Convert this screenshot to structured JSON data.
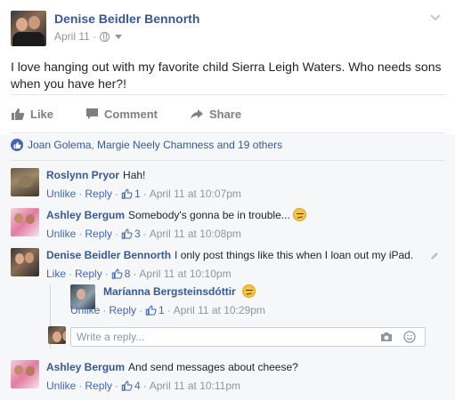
{
  "post": {
    "author": "Denise Beidler Bennorth",
    "date": "April 11 ·",
    "text": "I love hanging out with my favorite child Sierra Leigh Waters. Who needs sons when you have her?!"
  },
  "actions": {
    "like": "Like",
    "comment": "Comment",
    "share": "Share"
  },
  "likes_summary": "Joan Golema, Margie Neely Chamness and 19 others",
  "comments": [
    {
      "name": "Roslynn Pryor",
      "text": "Hah!",
      "action": "Unlike",
      "reply": "Reply",
      "likes": "1",
      "time": "April 11 at 10:07pm"
    },
    {
      "name": "Ashley Bergum",
      "text": "Somebody's gonna be in trouble...",
      "action": "Unlike",
      "reply": "Reply",
      "likes": "3",
      "time": "April 11 at 10:08pm"
    },
    {
      "name": "Denise Beidler Bennorth",
      "text": "I only post things like this when I loan out my iPad.",
      "action": "Like",
      "reply": "Reply",
      "likes": "8",
      "time": "April 11 at 10:10pm"
    },
    {
      "name": "Maríanna Bergsteinsdóttir",
      "text": "",
      "action": "Unlike",
      "reply": "Reply",
      "likes": "1",
      "time": "April 11 at 10:29pm"
    },
    {
      "name": "Ashley Bergum",
      "text": "And send messages about cheese?",
      "action": "Unlike",
      "reply": "Reply",
      "likes": "4",
      "time": "April 11 at 10:11pm"
    }
  ],
  "reply_box": {
    "placeholder": "Write a reply..."
  },
  "colors": {
    "link": "#365899",
    "meta": "#90949c",
    "like_blue": "#4267b2",
    "comments_bg": "#f6f7f9"
  }
}
